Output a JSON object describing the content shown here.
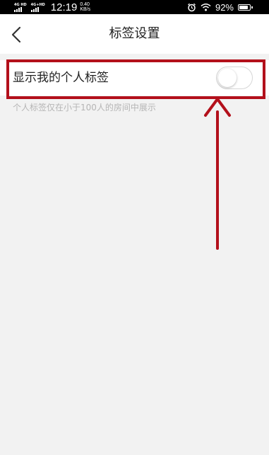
{
  "status_bar": {
    "net1": "4G HD",
    "net2": "4G+HD",
    "time": "12:19",
    "speed_value": "0.40",
    "speed_unit": "KB/s",
    "alarm_icon": "alarm-clock-icon",
    "wifi_icon": "wifi-icon",
    "battery_percent_text": "92%",
    "battery_level": 0.92
  },
  "header": {
    "back_icon": "chevron-left-icon",
    "title": "标签设置"
  },
  "setting": {
    "label": "显示我的个人标签",
    "toggle_on": false
  },
  "hint": "个人标签仅在小于100人的房间中展示",
  "annotation": {
    "color": "#b3101b"
  },
  "colors": {
    "background": "#f2f2f2",
    "panel": "#ffffff",
    "accent": "#b3101b"
  }
}
